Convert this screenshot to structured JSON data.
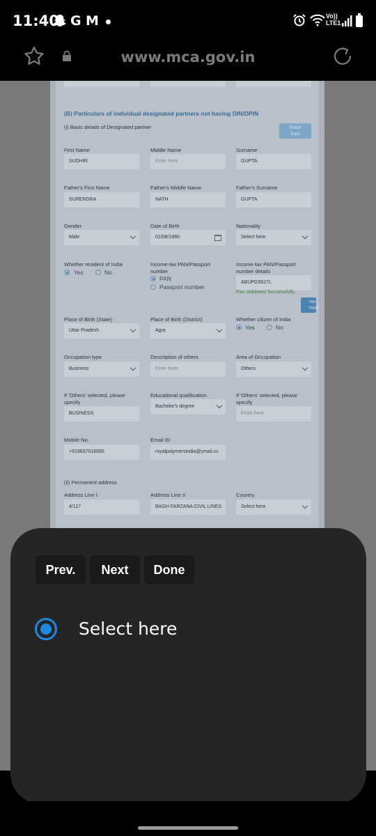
{
  "status_bar": {
    "time": "11:40",
    "icons": [
      "snapchat-icon",
      "google-icon",
      "gmail-icon",
      "alarm-icon",
      "wifi-icon",
      "signal-icon",
      "battery-icon"
    ],
    "g_label": "G",
    "m_label": "M",
    "volte_label_line1": "Vo))",
    "volte_label_line2": "LTE1"
  },
  "browser": {
    "url": "www.mca.gov.in"
  },
  "form": {
    "section_heading": "(B) Particulars of individual designated partners not having DIN/DPIN",
    "subsection_basic": "(i) Basic details of Designated partner",
    "fetch_button_line1": "Fetch",
    "fetch_button_line2": "from",
    "first_name": {
      "label": "First Name",
      "value": "SUDHIR"
    },
    "middle_name": {
      "label": "Middle Name",
      "placeholder": "Enter here"
    },
    "surname": {
      "label": "Surname",
      "value": "GUPTA"
    },
    "father_first": {
      "label": "Father's First Name",
      "value": "SURENDRA"
    },
    "father_middle": {
      "label": "Father's Middle Name",
      "value": "NATH"
    },
    "father_surname": {
      "label": "Father's Surname",
      "value": "GUPTA"
    },
    "gender": {
      "label": "Gender",
      "value": "Male"
    },
    "dob": {
      "label": "Date of Birth",
      "value": "01/08/1960"
    },
    "nationality": {
      "label": "Nationality",
      "value": "Select here"
    },
    "resident": {
      "label": "Whether resident of India",
      "yes": "Yes",
      "no": "No",
      "selected": "Yes"
    },
    "pan_type": {
      "label_line1": "Income-tax PAN/Passport",
      "label_line2": "number",
      "pan": "PAN",
      "passport": "Passport number",
      "selected": "PAN"
    },
    "pan_details": {
      "label_line1": "Income-tax PAN/Passport",
      "label_line2": "number details",
      "value": "ABUPG5627L",
      "validation": "Pan Validated Successfully."
    },
    "view_pan_line1": "Ver",
    "view_pan_line2": "PAN",
    "birth_state": {
      "label": "Place of Birth (State)",
      "value": "Uttar Pradesh"
    },
    "birth_district": {
      "label": "Place of Birth (District)",
      "value": "Agra"
    },
    "citizen": {
      "label": "Whether citizen of India",
      "yes": "Yes",
      "no": "No",
      "selected": "Yes"
    },
    "occupation": {
      "label": "Occupation type",
      "value": "Business"
    },
    "description_others": {
      "label": "Description of others",
      "placeholder": "Enter here"
    },
    "area_occupation": {
      "label": "Area of Occupation",
      "value": "Others"
    },
    "others_specify_1": {
      "label_line1": "If 'Others' selected, please",
      "label_line2": "specify",
      "value": "BUSINESS"
    },
    "education": {
      "label": "Educational qualification",
      "value": "Bachelor's degree"
    },
    "others_specify_2": {
      "label_line1": "If 'Others' selected, please",
      "label_line2": "specify",
      "placeholder": "Enter here"
    },
    "mobile": {
      "label": "Mobile No.",
      "value": "+919837018565"
    },
    "email": {
      "label": "Email ID",
      "value": "royalpolymersindia@ymail.cc"
    },
    "subsection_address": "(ii) Permanent address",
    "address1": {
      "label": "Address Line I",
      "value": "4/117"
    },
    "address2": {
      "label": "Address Line II",
      "value": "BAGH FARZANA CIVIL LINES"
    },
    "country": {
      "label": "Country",
      "value": "Select here"
    }
  },
  "picker": {
    "prev_label": "Prev.",
    "next_label": "Next",
    "done_label": "Done",
    "option_label": "Select here",
    "accent_color": "#1e88e5"
  }
}
